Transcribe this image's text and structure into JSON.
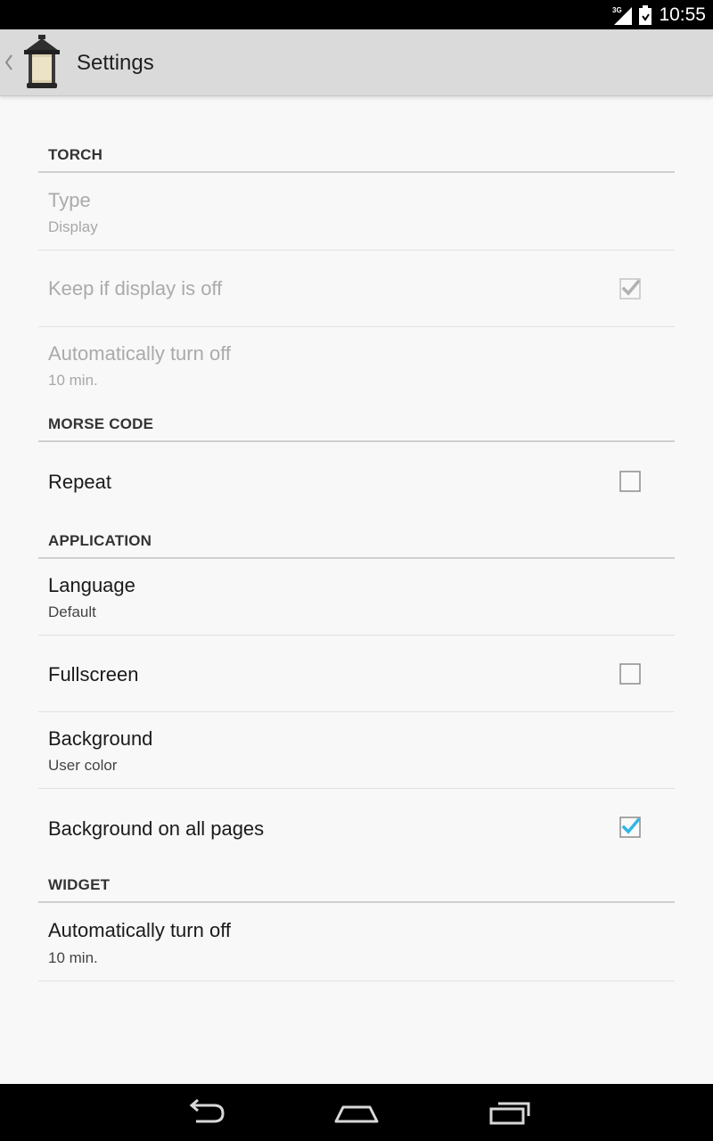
{
  "status_bar": {
    "network_label": "3G",
    "time": "10:55",
    "icons": [
      "signal-3g-icon",
      "battery-icon"
    ]
  },
  "action_bar": {
    "title": "Settings",
    "icons": [
      "up-caret-icon",
      "lantern-app-icon"
    ]
  },
  "sections": {
    "torch": {
      "header": "TORCH",
      "type": {
        "title": "Type",
        "summary": "Display"
      },
      "keep_display_off": {
        "title": "Keep if display is off",
        "checked": true
      },
      "auto_off": {
        "title": "Automatically turn off",
        "summary": "10 min."
      }
    },
    "morse": {
      "header": "MORSE CODE",
      "repeat": {
        "title": "Repeat",
        "checked": false
      }
    },
    "application": {
      "header": "APPLICATION",
      "language": {
        "title": "Language",
        "summary": "Default"
      },
      "fullscreen": {
        "title": "Fullscreen",
        "checked": false
      },
      "background": {
        "title": "Background",
        "summary": "User color"
      },
      "background_all_pages": {
        "title": "Background on all pages",
        "checked": true
      }
    },
    "widget": {
      "header": "WIDGET",
      "auto_off": {
        "title": "Automatically turn off",
        "summary": "10 min."
      }
    }
  },
  "nav_bar": {
    "icons": [
      "back-icon",
      "home-icon",
      "recent-apps-icon"
    ]
  },
  "colors": {
    "check_accent": "#33b5e5",
    "check_disabled": "#b0b0b0",
    "action_bar": "#dadada",
    "background": "#f8f8f8"
  }
}
